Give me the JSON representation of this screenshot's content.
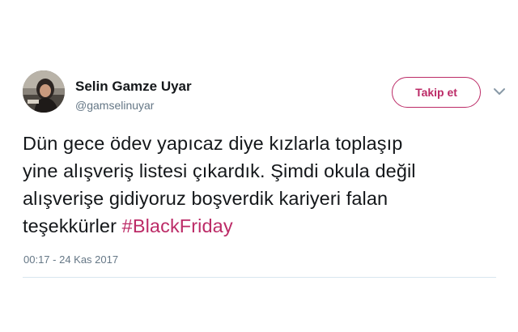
{
  "user": {
    "display_name": "Selin Gamze Uyar",
    "handle": "@gamselinuyar",
    "avatar_icon": "profile-photo"
  },
  "actions": {
    "follow_label": "Takip et",
    "more_icon": "chevron-down-icon"
  },
  "tweet": {
    "lines": [
      "Dün gece ödev yapıcaz diye kızlarla toplaşıp",
      "yine alışveriş listesi çıkardık. Şimdi okula değil",
      "alışverişe gidiyoruz boşverdik kariyeri falan",
      "teşekkürler "
    ],
    "hashtag": "#BlackFriday",
    "timestamp": "00:17 - 24 Kas 2017"
  },
  "colors": {
    "accent": "#bc2b67",
    "text": "#14171a",
    "muted": "#657786",
    "divider": "#d8e6ef"
  }
}
